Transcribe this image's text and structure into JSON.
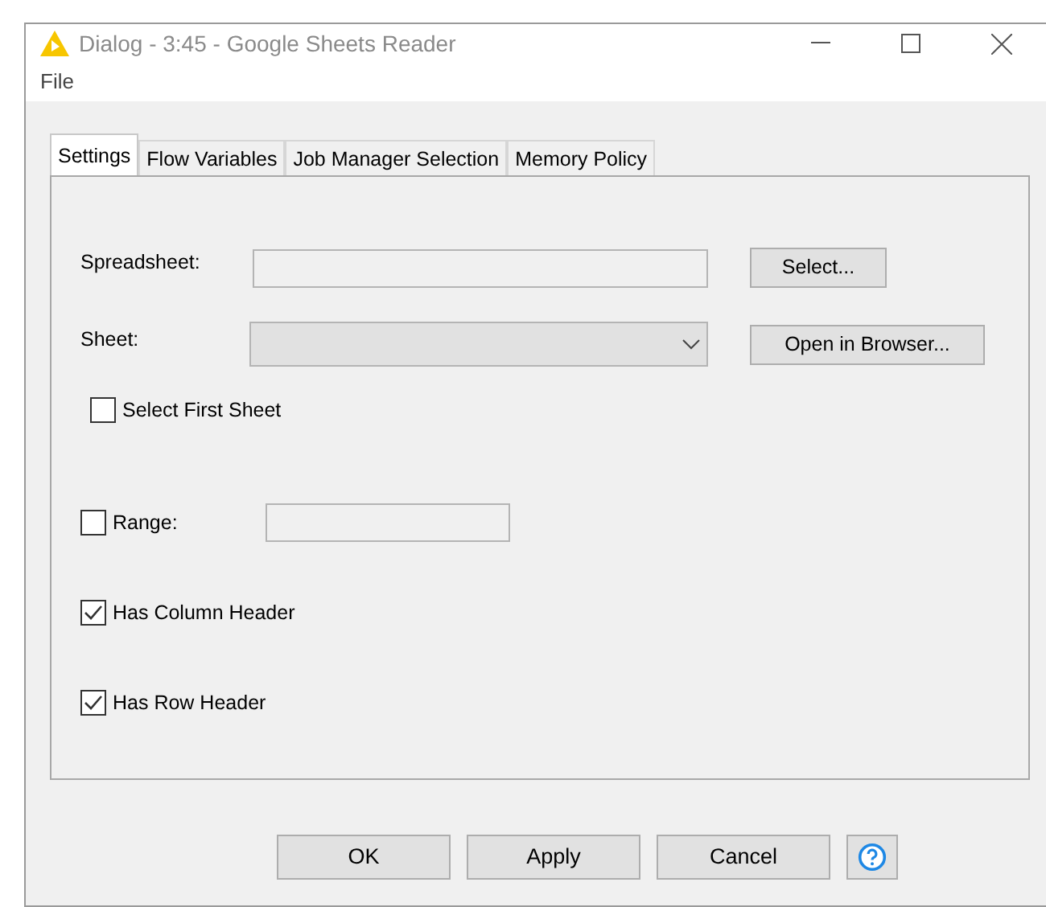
{
  "window": {
    "title": "Dialog - 3:45 - Google Sheets Reader"
  },
  "menu": [
    "File"
  ],
  "tabs": [
    {
      "label": "Settings",
      "selected": true
    },
    {
      "label": "Flow Variables",
      "selected": false
    },
    {
      "label": "Job Manager Selection",
      "selected": false
    },
    {
      "label": "Memory Policy",
      "selected": false
    }
  ],
  "spreadsheet": {
    "label": "Spreadsheet:",
    "button": "Select..."
  },
  "sheet": {
    "label": "Sheet:",
    "disabled": true,
    "button": "Open in Browser..."
  },
  "options": [
    {
      "kind": "checkbox",
      "label": "Select First Sheet",
      "checked": false
    },
    {
      "kind": "range",
      "label": "Range:",
      "checked": false
    },
    {
      "kind": "checkbox",
      "label": "Has Column Header",
      "checked": true
    },
    {
      "kind": "checkbox",
      "label": "Has Row Header",
      "checked": true
    }
  ],
  "buttons": [
    "OK",
    "Apply",
    "Cancel"
  ]
}
